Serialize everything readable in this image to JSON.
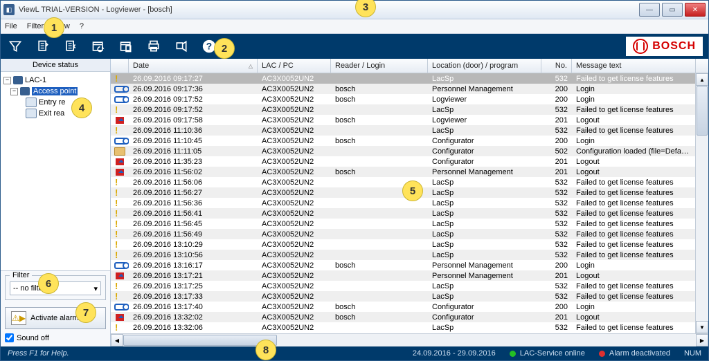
{
  "window": {
    "title": "ViewL     TRIAL-VERSION - Logviewer - [bosch]"
  },
  "menu": [
    "File",
    "Filter",
    "View",
    "?"
  ],
  "brand": "BOSCH",
  "sidebar": {
    "heading": "Device status",
    "tree": {
      "root": "LAC-1",
      "child": "Access point",
      "leaves": [
        "Entry re",
        "Exit rea"
      ]
    },
    "filter_caption": "Filter",
    "filter_value": "-- no filter --",
    "activate": "Activate alarm",
    "sound_off": "Sound off"
  },
  "columns": {
    "date": "Date",
    "lac": "LAC / PC",
    "reader": "Reader / Login",
    "loc": "Location (door) / program",
    "no": "No.",
    "msg": "Message text"
  },
  "rows": [
    {
      "icon": "warn",
      "date": "26.09.2016 09:17:27",
      "lac": "AC3X0052UN2",
      "reader": "",
      "loc": "LacSp",
      "no": 532,
      "msg": "Failed to get license features",
      "sel": true
    },
    {
      "icon": "key",
      "date": "26.09.2016 09:17:36",
      "lac": "AC3X0052UN2",
      "reader": "bosch",
      "loc": "Personnel Management",
      "no": 200,
      "msg": "Login"
    },
    {
      "icon": "key",
      "date": "26.09.2016 09:17:52",
      "lac": "AC3X0052UN2",
      "reader": "bosch",
      "loc": "Logviewer",
      "no": 200,
      "msg": "Login"
    },
    {
      "icon": "warn",
      "date": "26.09.2016 09:17:52",
      "lac": "AC3X0052UN2",
      "reader": "",
      "loc": "LacSp",
      "no": 532,
      "msg": "Failed to get license features"
    },
    {
      "icon": "logout",
      "date": "26.09.2016 09:17:58",
      "lac": "AC3X0052UN2",
      "reader": "bosch",
      "loc": "Logviewer",
      "no": 201,
      "msg": "Logout"
    },
    {
      "icon": "warn",
      "date": "26.09.2016 11:10:36",
      "lac": "AC3X0052UN2",
      "reader": "",
      "loc": "LacSp",
      "no": 532,
      "msg": "Failed to get license features"
    },
    {
      "icon": "key",
      "date": "26.09.2016 11:10:45",
      "lac": "AC3X0052UN2",
      "reader": "bosch",
      "loc": "Configurator",
      "no": 200,
      "msg": "Login"
    },
    {
      "icon": "folder",
      "date": "26.09.2016 11:11:05",
      "lac": "AC3X0052UN2",
      "reader": "",
      "loc": "Configurator",
      "no": 502,
      "msg": "Configuration loaded (file=Default..."
    },
    {
      "icon": "logout",
      "date": "26.09.2016 11:35:23",
      "lac": "AC3X0052UN2",
      "reader": "",
      "loc": "Configurator",
      "no": 201,
      "msg": "Logout"
    },
    {
      "icon": "logout",
      "date": "26.09.2016 11:56:02",
      "lac": "AC3X0052UN2",
      "reader": "bosch",
      "loc": "Personnel Management",
      "no": 201,
      "msg": "Logout"
    },
    {
      "icon": "warn",
      "date": "26.09.2016 11:56:06",
      "lac": "AC3X0052UN2",
      "reader": "",
      "loc": "LacSp",
      "no": 532,
      "msg": "Failed to get license features"
    },
    {
      "icon": "warn",
      "date": "26.09.2016 11:56:27",
      "lac": "AC3X0052UN2",
      "reader": "",
      "loc": "LacSp",
      "no": 532,
      "msg": "Failed to get license features"
    },
    {
      "icon": "warn",
      "date": "26.09.2016 11:56:36",
      "lac": "AC3X0052UN2",
      "reader": "",
      "loc": "LacSp",
      "no": 532,
      "msg": "Failed to get license features"
    },
    {
      "icon": "warn",
      "date": "26.09.2016 11:56:41",
      "lac": "AC3X0052UN2",
      "reader": "",
      "loc": "LacSp",
      "no": 532,
      "msg": "Failed to get license features"
    },
    {
      "icon": "warn",
      "date": "26.09.2016 11:56:45",
      "lac": "AC3X0052UN2",
      "reader": "",
      "loc": "LacSp",
      "no": 532,
      "msg": "Failed to get license features"
    },
    {
      "icon": "warn",
      "date": "26.09.2016 11:56:49",
      "lac": "AC3X0052UN2",
      "reader": "",
      "loc": "LacSp",
      "no": 532,
      "msg": "Failed to get license features"
    },
    {
      "icon": "warn",
      "date": "26.09.2016 13:10:29",
      "lac": "AC3X0052UN2",
      "reader": "",
      "loc": "LacSp",
      "no": 532,
      "msg": "Failed to get license features"
    },
    {
      "icon": "warn",
      "date": "26.09.2016 13:10:56",
      "lac": "AC3X0052UN2",
      "reader": "",
      "loc": "LacSp",
      "no": 532,
      "msg": "Failed to get license features"
    },
    {
      "icon": "key",
      "date": "26.09.2016 13:16:17",
      "lac": "AC3X0052UN2",
      "reader": "bosch",
      "loc": "Personnel Management",
      "no": 200,
      "msg": "Login"
    },
    {
      "icon": "logout",
      "date": "26.09.2016 13:17:21",
      "lac": "AC3X0052UN2",
      "reader": "",
      "loc": "Personnel Management",
      "no": 201,
      "msg": "Logout"
    },
    {
      "icon": "warn",
      "date": "26.09.2016 13:17:25",
      "lac": "AC3X0052UN2",
      "reader": "",
      "loc": "LacSp",
      "no": 532,
      "msg": "Failed to get license features"
    },
    {
      "icon": "warn",
      "date": "26.09.2016 13:17:33",
      "lac": "AC3X0052UN2",
      "reader": "",
      "loc": "LacSp",
      "no": 532,
      "msg": "Failed to get license features"
    },
    {
      "icon": "key",
      "date": "26.09.2016 13:17:40",
      "lac": "AC3X0052UN2",
      "reader": "bosch",
      "loc": "Configurator",
      "no": 200,
      "msg": "Login"
    },
    {
      "icon": "logout",
      "date": "26.09.2016 13:32:02",
      "lac": "AC3X0052UN2",
      "reader": "bosch",
      "loc": "Configurator",
      "no": 201,
      "msg": "Logout"
    },
    {
      "icon": "warn",
      "date": "26.09.2016 13:32:06",
      "lac": "AC3X0052UN2",
      "reader": "",
      "loc": "LacSp",
      "no": 532,
      "msg": "Failed to get license features"
    }
  ],
  "status": {
    "help": "Press F1 for Help.",
    "range": "24.09.2016 - 29.09.2016",
    "service": "LAC-Service online",
    "alarm": "Alarm deactivated",
    "num": "NUM"
  },
  "callouts": {
    "1": "1",
    "2": "2",
    "3": "3",
    "4": "4",
    "5": "5",
    "6": "6",
    "7": "7",
    "8": "8"
  }
}
